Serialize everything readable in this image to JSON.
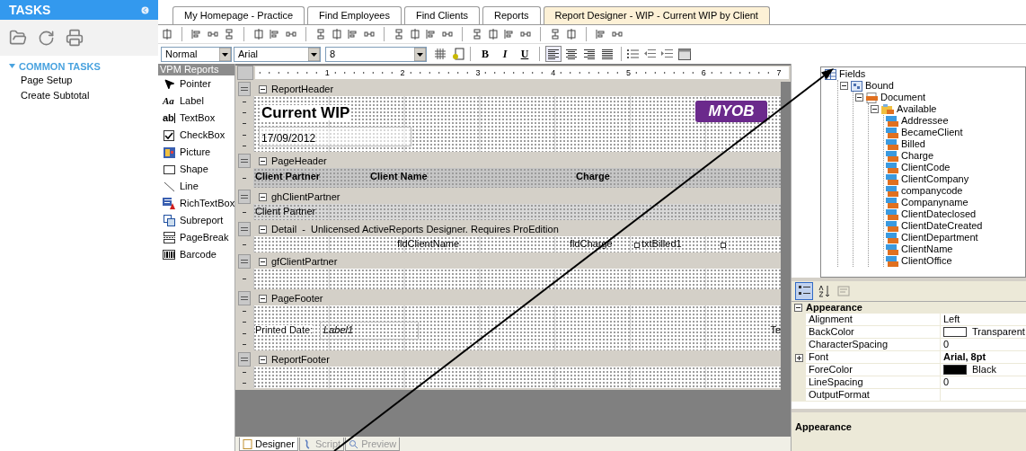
{
  "tasks": {
    "title": "TASKS",
    "groups": [
      {
        "title": "COMMON TASKS",
        "expanded": true,
        "items": [
          "Page Setup",
          "Create Subtotal"
        ]
      }
    ]
  },
  "tabs": [
    {
      "label": "My Homepage - Practice",
      "selected": false
    },
    {
      "label": "Find Employees",
      "selected": false
    },
    {
      "label": "Find Clients",
      "selected": false
    },
    {
      "label": "Reports",
      "selected": false
    },
    {
      "label": "Report Designer - WIP - Current WIP by Client",
      "selected": true
    }
  ],
  "format_bar": {
    "style": "Normal",
    "font": "Arial",
    "size": "8",
    "text_styles": [
      {
        "label": "B",
        "kind": "bold"
      },
      {
        "label": "I",
        "kind": "italic"
      },
      {
        "label": "U",
        "kind": "underline"
      }
    ],
    "alignment": [
      {
        "kind": "left",
        "selected": true
      },
      {
        "kind": "center",
        "selected": false
      },
      {
        "kind": "right",
        "selected": false
      },
      {
        "kind": "justify",
        "selected": false
      }
    ]
  },
  "toolbox": {
    "title": "VPM Reports",
    "items": [
      {
        "label": "Pointer",
        "kind": "pointer"
      },
      {
        "label": "Label",
        "kind": "label",
        "glyph": "Aa"
      },
      {
        "label": "TextBox",
        "kind": "textbox",
        "glyph": "ab"
      },
      {
        "label": "CheckBox",
        "kind": "checkbox"
      },
      {
        "label": "Picture",
        "kind": "picture"
      },
      {
        "label": "Shape",
        "kind": "shape"
      },
      {
        "label": "Line",
        "kind": "line"
      },
      {
        "label": "RichTextBox",
        "kind": "richtext"
      },
      {
        "label": "Subreport",
        "kind": "subreport"
      },
      {
        "label": "PageBreak",
        "kind": "pagebreak"
      },
      {
        "label": "Barcode",
        "kind": "barcode"
      }
    ]
  },
  "ruler": {
    "marks": [
      "1",
      "2",
      "3",
      "4",
      "5",
      "6",
      "7"
    ]
  },
  "sections": [
    {
      "title": "ReportHeader",
      "kind": "report_header",
      "expanded": true,
      "items": [
        "Current WIP",
        "17/09/2012",
        "MYOB"
      ]
    },
    {
      "title": "PageHeader",
      "kind": "page_header",
      "expanded": true,
      "items": [
        "Client Partner",
        "Client Name",
        "Charge"
      ]
    },
    {
      "title": "ghClientPartner",
      "kind": "group_header",
      "expanded": true,
      "items": [
        "Client Partner"
      ]
    },
    {
      "title": "Detail  -  Unlicensed ActiveReports Designer. Requires ProEdition",
      "kind": "detail",
      "expanded": true,
      "items": [
        "fldClientName",
        "fldCharge",
        "txtBilled1"
      ]
    },
    {
      "title": "gfClientPartner",
      "kind": "group_footer",
      "expanded": true
    },
    {
      "title": "PageFooter",
      "kind": "page_footer",
      "expanded": true,
      "items": [
        "Printed Date:",
        "Label1",
        "Te"
      ]
    },
    {
      "title": "ReportFooter",
      "kind": "report_footer",
      "expanded": true
    }
  ],
  "bottom_tabs": [
    {
      "label": "Designer",
      "kind": "designer",
      "selected": true
    },
    {
      "label": "Script",
      "kind": "script",
      "selected": false
    },
    {
      "label": "Preview",
      "kind": "preview",
      "selected": false
    }
  ],
  "fields_tree": {
    "label": "Fields",
    "kind": "root",
    "children": [
      {
        "label": "Bound",
        "kind": "bound",
        "expanded": true,
        "children": [
          {
            "label": "Document",
            "kind": "document",
            "expanded": true,
            "children": [
              {
                "label": "Available",
                "kind": "folder",
                "expanded": true,
                "children": [
                  {
                    "label": "Addressee",
                    "kind": "field"
                  },
                  {
                    "label": "BecameClient",
                    "kind": "field"
                  },
                  {
                    "label": "Billed",
                    "kind": "field"
                  },
                  {
                    "label": "Charge",
                    "kind": "field"
                  },
                  {
                    "label": "ClientCode",
                    "kind": "field"
                  },
                  {
                    "label": "ClientCompany",
                    "kind": "field"
                  },
                  {
                    "label": "companycode",
                    "kind": "field"
                  },
                  {
                    "label": "Companyname",
                    "kind": "field"
                  },
                  {
                    "label": "ClientDateclosed",
                    "kind": "field"
                  },
                  {
                    "label": "ClientDateCreated",
                    "kind": "field"
                  },
                  {
                    "label": "ClientDepartment",
                    "kind": "field"
                  },
                  {
                    "label": "ClientName",
                    "kind": "field"
                  },
                  {
                    "label": "ClientOffice",
                    "kind": "field"
                  }
                ]
              }
            ]
          }
        ]
      }
    ]
  },
  "properties": {
    "toolbar": [
      {
        "kind": "categorized",
        "selected": true,
        "disabled": false
      },
      {
        "kind": "alphabetical",
        "selected": false,
        "disabled": false
      },
      {
        "kind": "pages",
        "selected": false,
        "disabled": true
      }
    ],
    "category": {
      "title": "Appearance",
      "expanded": true
    },
    "rows": [
      {
        "name": "Alignment",
        "value": "Left"
      },
      {
        "name": "BackColor",
        "value": "Transparent",
        "color": "#ffffff"
      },
      {
        "name": "CharacterSpacing",
        "value": "0"
      },
      {
        "name": "Font",
        "value": "Arial, 8pt",
        "expandable": true,
        "expanded": false,
        "bold": true
      },
      {
        "name": "ForeColor",
        "value": "Black",
        "color": "#000000"
      },
      {
        "name": "LineSpacing",
        "value": "0"
      },
      {
        "name": "OutputFormat"
      }
    ],
    "description": "Appearance"
  }
}
